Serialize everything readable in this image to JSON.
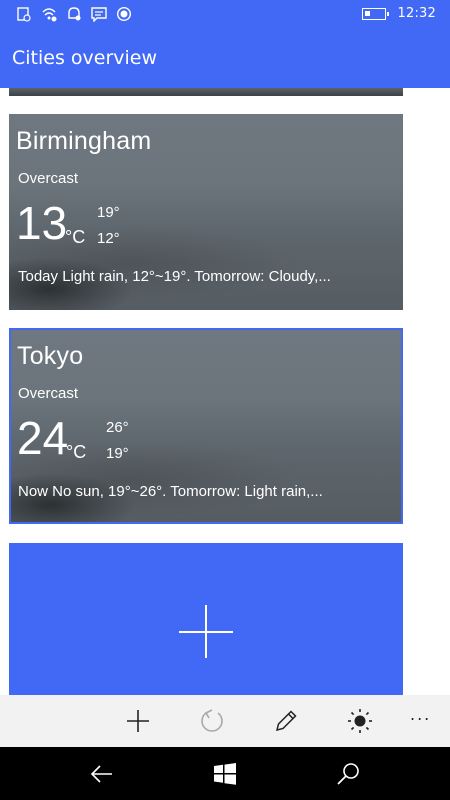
{
  "status_bar": {
    "time": "12:32",
    "icons": [
      "mobile-data-icon",
      "wifi-call-icon",
      "notification-icon",
      "message-icon",
      "record-icon"
    ],
    "battery_level": 0.25
  },
  "header": {
    "title": "Cities overview"
  },
  "cities": [
    {
      "name": "Birmingham",
      "condition": "Overcast",
      "temperature": "13",
      "unit": "°C",
      "high": "19°",
      "low": "12°",
      "summary": "Today Light rain, 12°~19°. Tomorrow: Cloudy,..."
    },
    {
      "name": "Tokyo",
      "condition": "Overcast",
      "temperature": "24",
      "unit": "°C",
      "high": "26°",
      "low": "19°",
      "summary": "Now No sun, 19°~26°. Tomorrow: Light rain,..."
    }
  ],
  "app_bar": {
    "buttons": [
      "add-icon",
      "refresh-icon",
      "edit-icon",
      "brightness-icon",
      "more-icon"
    ],
    "more_label": "..."
  },
  "nav_bar": {
    "buttons": [
      "back-icon",
      "windows-start-icon",
      "search-icon"
    ]
  },
  "colors": {
    "accent": "#4169f5",
    "appbar": "#f2f2f2",
    "navbar": "#000000"
  }
}
